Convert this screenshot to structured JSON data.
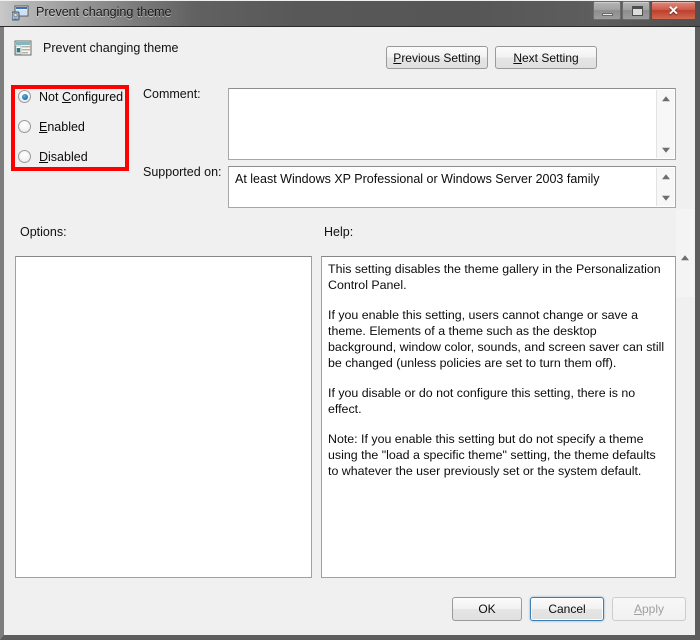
{
  "window": {
    "title": "Prevent changing theme",
    "icon": "policy-setting-icon",
    "controls": {
      "minimize": "minimize-button",
      "maximize": "maximize-button",
      "close": "close-button"
    }
  },
  "header": {
    "icon": "setting-properties-icon",
    "title": "Prevent changing theme"
  },
  "nav": {
    "previous_label": "Previous Setting",
    "previous_accel": "P",
    "next_label": "Next Setting",
    "next_accel": "N"
  },
  "state_options": {
    "selected": "Not Configured",
    "items": [
      {
        "label": "Not Configured",
        "accel": "C",
        "pre": "Not ",
        "post": "onfigured",
        "checked": true
      },
      {
        "label": "Enabled",
        "accel": "E",
        "pre": "",
        "post": "nabled",
        "checked": false
      },
      {
        "label": "Disabled",
        "accel": "D",
        "pre": "",
        "post": "isabled",
        "checked": false
      }
    ],
    "highlight_color": "#ff0000"
  },
  "fields": {
    "comment_label": "Comment:",
    "comment_value": "",
    "supported_label": "Supported on:",
    "supported_value": "At least Windows XP Professional or Windows Server 2003 family"
  },
  "panes": {
    "options_label": "Options:",
    "options_content": "",
    "help_label": "Help:",
    "help_paragraphs": [
      "This setting disables the theme gallery in the Personalization Control Panel.",
      "If you enable this setting, users cannot change or save a theme. Elements of a theme such as the desktop background, window color, sounds, and screen saver can still be changed (unless policies are set to turn them off).",
      "If you disable or do not configure this setting, there is no effect.",
      "Note: If you enable this setting but do not specify a theme using the \"load a specific theme\" setting, the theme defaults to whatever the user previously set or the system default."
    ]
  },
  "footer": {
    "ok_label": "OK",
    "cancel_label": "Cancel",
    "apply_label": "Apply",
    "apply_accel": "A",
    "apply_disabled": true,
    "default_button": "Cancel"
  },
  "colors": {
    "dialog_bg": "#f0f0f0",
    "field_bg": "#ffffff",
    "accent_focus": "#3c7fb1",
    "annotation_red": "#ff0000",
    "titlebar_dark": "#565656",
    "close_red": "#cf5a48"
  }
}
